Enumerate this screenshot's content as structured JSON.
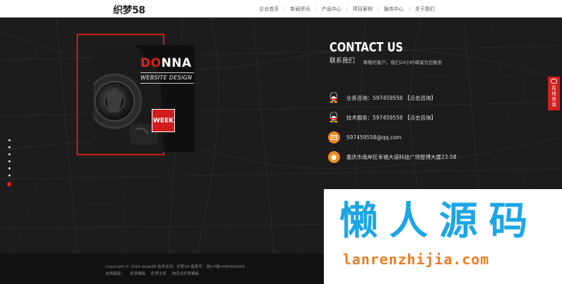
{
  "header": {
    "logo": "织梦58",
    "nav": [
      "企业首页",
      "新闻资讯",
      "产品中心",
      "项目案例",
      "服务中心",
      "关于我们"
    ]
  },
  "poster": {
    "title_red": "DO",
    "title_white": "NNA",
    "subtitle": "WEBSITE DESIGN",
    "badge": "WEEK"
  },
  "contact": {
    "title": "CONTACT US",
    "subtitle": "联系我们",
    "note": "尊敬的客户，我们24小时竭诚为您服务",
    "items": [
      {
        "icon": "qq-icon",
        "text": "业务咨询：597459558 【点击咨询】"
      },
      {
        "icon": "qq-icon",
        "text": "技术服务：597459558 【点击咨询】"
      },
      {
        "icon": "email-icon",
        "text": "597459558@qq.com"
      },
      {
        "icon": "home-icon",
        "text": "重庆市南岸区幸福大道科技广场智博大厦23-58"
      }
    ]
  },
  "online_tab": {
    "label": "在线咨询"
  },
  "footer": {
    "line1": "Copyright © 2016 dede58   技术支持：织梦58   备案号：渝ICP备0486389358",
    "links_label": "友情链接：",
    "links": [
      "织梦模板",
      "织梦主机",
      "响应式织梦模板"
    ]
  },
  "watermark": {
    "cn": "懒人源码",
    "url": "lanrenzhijia.com"
  },
  "colors": {
    "accent": "#d21b1b",
    "dark_bg": "#1c1c1c",
    "watermark_blue": "#1da6e6",
    "watermark_orange": "#f07a20",
    "home_icon": "#f08a24"
  }
}
